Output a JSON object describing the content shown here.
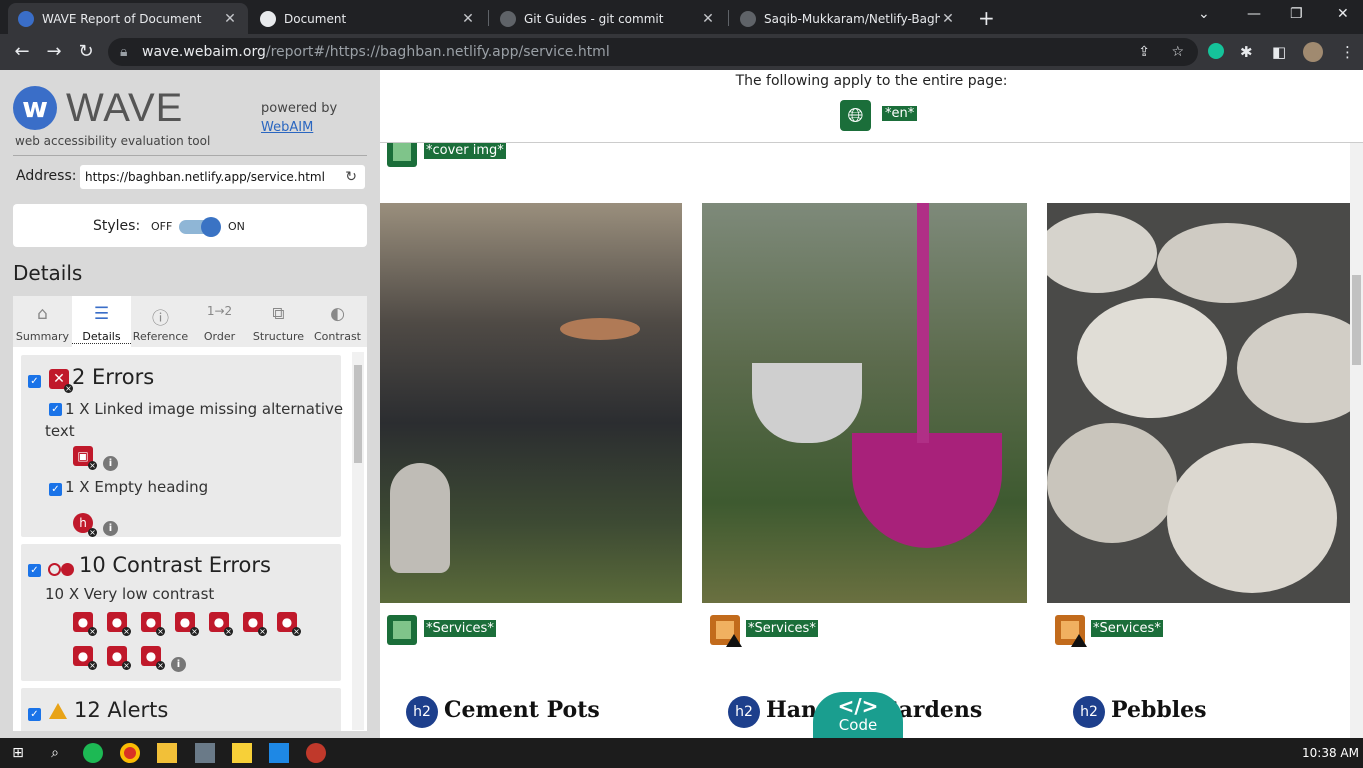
{
  "browser": {
    "tabs": [
      {
        "title": "WAVE Report of Document"
      },
      {
        "title": "Document"
      },
      {
        "title": "Git Guides - git commit"
      },
      {
        "title": "Saqib-Mukkaram/Netlify-Baghba"
      }
    ],
    "url_host": "wave.webaim.org",
    "url_path": "/report#/https://baghban.netlify.app/service.html"
  },
  "wave": {
    "title": "WAVE",
    "tagline": "web accessibility evaluation tool",
    "powered_by": "powered by",
    "webaim_link": "WebAIM",
    "address_label": "Address:",
    "address_value": "https://baghban.netlify.app/service.html",
    "styles_label": "Styles:",
    "styles_off": "OFF",
    "styles_on": "ON",
    "styles_state": "on",
    "details_heading": "Details",
    "tabs": [
      {
        "label": "Summary",
        "icon": "home-icon"
      },
      {
        "label": "Details",
        "icon": "list-icon"
      },
      {
        "label": "Reference",
        "icon": "info-icon"
      },
      {
        "label": "Order",
        "icon": "order-icon"
      },
      {
        "label": "Structure",
        "icon": "structure-icon"
      },
      {
        "label": "Contrast",
        "icon": "contrast-icon"
      }
    ],
    "active_tab": "Details",
    "errors": {
      "title": "2 Errors",
      "items": [
        {
          "text": "1 X Linked image missing alternative text"
        },
        {
          "text": "1 X Empty heading"
        }
      ]
    },
    "contrast": {
      "title": "10 Contrast Errors",
      "subtitle": "10 X Very low contrast",
      "count": 10
    },
    "alerts": {
      "title": "12 Alerts"
    }
  },
  "page": {
    "apply_text": "The following apply to the entire page:",
    "lang_tag": "*en*",
    "cover_tag": "*cover img*",
    "services_tag": "*Services*",
    "cards": [
      {
        "heading": "Cement Pots",
        "badge": "h2"
      },
      {
        "heading": "Hanging Gardens",
        "badge": "h2"
      },
      {
        "heading": "Pebbles",
        "badge": "h2"
      }
    ],
    "code_button": "Code"
  },
  "taskbar": {
    "time": "10:38 AM"
  }
}
